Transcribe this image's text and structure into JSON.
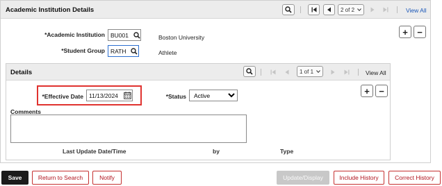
{
  "institution_panel": {
    "title": "Academic Institution Details",
    "pager": "2 of 2",
    "view_all": "View All",
    "institution_label": "*Academic Institution",
    "institution_value": "BU001",
    "institution_desc": "Boston University",
    "student_group_label": "*Student Group",
    "student_group_value": "RATH",
    "student_group_desc": "Athlete",
    "add_symbol": "+",
    "remove_symbol": "−"
  },
  "details_panel": {
    "title": "Details",
    "pager": "1 of 1",
    "view_all": "View All",
    "effective_date_label": "*Effective Date",
    "effective_date_value": "11/13/2024",
    "status_label": "*Status",
    "status_value": "Active",
    "comments_label": "Comments",
    "columns": [
      "Last Update Date/Time",
      "by",
      "Type"
    ],
    "add_symbol": "+",
    "remove_symbol": "−"
  },
  "toolbar": {
    "save": "Save",
    "return_to_search": "Return to Search",
    "notify": "Notify",
    "update_display": "Update/Display",
    "include_history": "Include History",
    "correct_history": "Correct History"
  },
  "colors": {
    "accent_red": "#b0121c",
    "highlight_red": "#e0322f",
    "link_blue": "#1a57b8",
    "header_grey": "#ececec"
  },
  "icons": {
    "search": "magnifier-icon",
    "first": "first-page-icon",
    "prev": "previous-icon",
    "next": "next-icon",
    "last": "last-page-icon",
    "calendar": "calendar-icon",
    "dropdown": "chevron-down-icon"
  }
}
